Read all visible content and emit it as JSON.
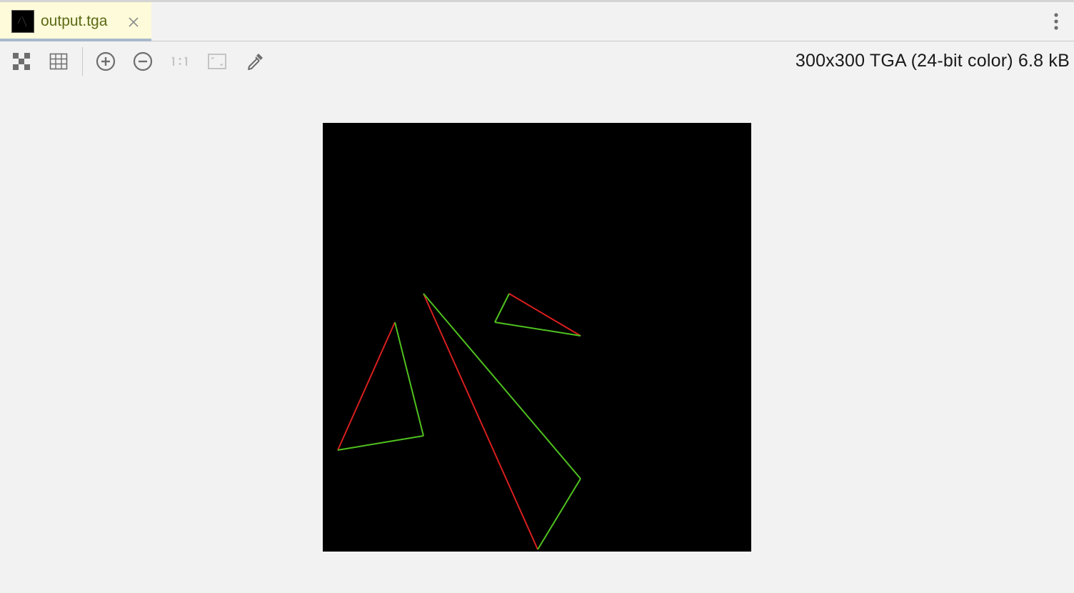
{
  "tab": {
    "filename": "output.tga",
    "thumbnail_icon": "image-thumbnail-icon",
    "close_icon": "close-icon"
  },
  "menu_icon": "more-vertical-icon",
  "toolbar": {
    "buttons": [
      {
        "name": "chessboard-icon"
      },
      {
        "name": "grid-icon"
      },
      {
        "name": "zoom-in-icon"
      },
      {
        "name": "zoom-out-icon"
      },
      {
        "name": "actual-size-icon"
      },
      {
        "name": "fit-to-window-icon"
      },
      {
        "name": "color-picker-icon"
      }
    ],
    "image_info": "300x300 TGA (24-bit color) 6.8 kB"
  },
  "image": {
    "background": "#000000",
    "line_colors": {
      "red": "#d81e1e",
      "green": "#4fc11f"
    }
  }
}
